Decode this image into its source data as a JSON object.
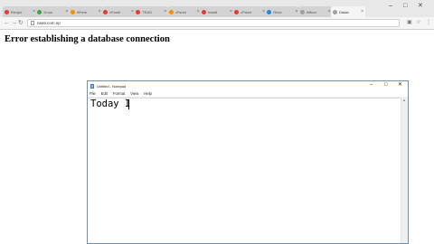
{
  "browser": {
    "tabs": [
      {
        "label": "Recipe",
        "color": "#e53935"
      },
      {
        "label": "Grow",
        "color": "#43a047"
      },
      {
        "label": "Where",
        "color": "#fb8c00"
      },
      {
        "label": "cPanel",
        "color": "#e53935"
      },
      {
        "label": "TRAD",
        "color": "#e53935"
      },
      {
        "label": "cPanel",
        "color": "#fb8c00"
      },
      {
        "label": "Install",
        "color": "#e53935"
      },
      {
        "label": "cPanel",
        "color": "#e53935"
      },
      {
        "label": "Rese",
        "color": "#1e88e5"
      },
      {
        "label": "Wiktor",
        "color": "#9e9e9e"
      },
      {
        "label": "Datab",
        "color": "#9e9e9e"
      }
    ],
    "active_tab_index": 10,
    "tab_close_glyph": "×",
    "url": "rieati.com.np",
    "window_controls": {
      "minimize": "–",
      "maximize": "□",
      "close": "✕"
    }
  },
  "page": {
    "heading": "Error establishing a database connection"
  },
  "notepad": {
    "title": "Untitled - Notepad",
    "menu": [
      "File",
      "Edit",
      "Format",
      "View",
      "Help"
    ],
    "content": "Today I",
    "window_controls": {
      "minimize": "–",
      "maximize": "□",
      "close": "✕"
    }
  }
}
